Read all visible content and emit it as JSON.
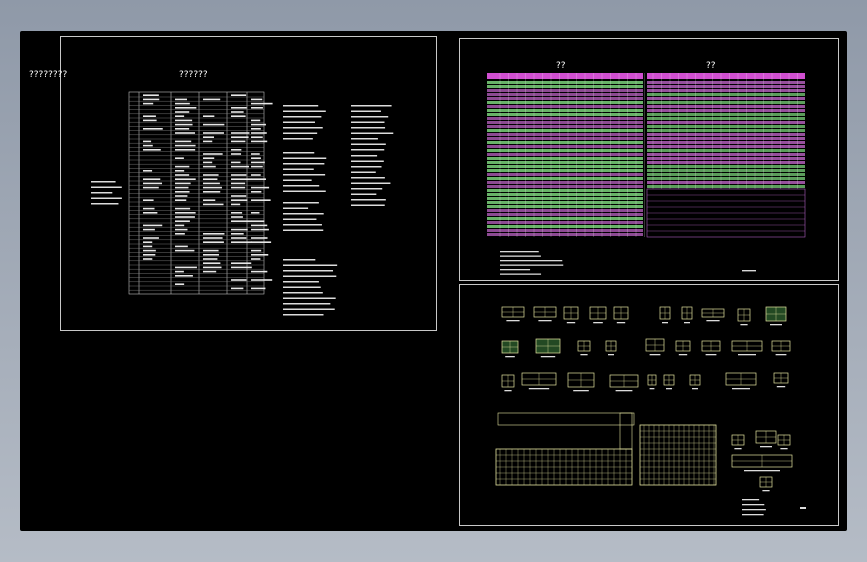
{
  "sheets": {
    "left": {
      "title_outside": "????????",
      "title_table": "??????"
    },
    "top_right": {
      "header_left": "??",
      "header_right": "??"
    }
  },
  "colors": {
    "background": "#000000",
    "sheet_border": "#c8c8c8",
    "table_header": "#d04fd0",
    "table_fill": "#7ad17a",
    "drawing_lines": "#e5e5a0",
    "grid_lines": "#bfbfbf"
  }
}
